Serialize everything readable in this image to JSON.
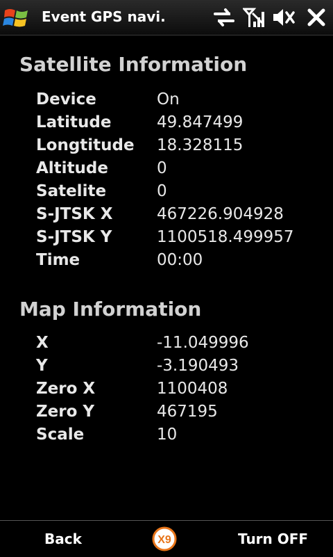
{
  "titlebar": {
    "app_title": "Event GPS navi.",
    "icons": [
      "windows-start-icon",
      "sync-arrows-icon",
      "signal-strength-icon",
      "volume-muted-icon",
      "close-icon"
    ]
  },
  "satellite": {
    "title": "Satellite Information",
    "rows": [
      {
        "label": "Device",
        "value": "On"
      },
      {
        "label": "Latitude",
        "value": "49.847499"
      },
      {
        "label": "Longtitude",
        "value": "18.328115"
      },
      {
        "label": "Altitude",
        "value": "0"
      },
      {
        "label": "Satelite",
        "value": "0"
      },
      {
        "label": "S-JTSK X",
        "value": "467226.904928"
      },
      {
        "label": "S-JTSK Y",
        "value": "1100518.499957"
      },
      {
        "label": "Time",
        "value": "00:00"
      }
    ]
  },
  "map": {
    "title": "Map Information",
    "rows": [
      {
        "label": "X",
        "value": "-11.049996"
      },
      {
        "label": "Y",
        "value": "-3.190493"
      },
      {
        "label": "Zero X",
        "value": "1100408"
      },
      {
        "label": "Zero Y",
        "value": "467195"
      },
      {
        "label": "Scale",
        "value": "10"
      }
    ]
  },
  "menubar": {
    "left_label": "Back",
    "right_label": "Turn OFF",
    "center_logo_text": "X9"
  },
  "colors": {
    "background": "#000000",
    "text": "#e8e8e8",
    "section_title": "#d2d2d2",
    "logo_orange": "#e8751a"
  }
}
